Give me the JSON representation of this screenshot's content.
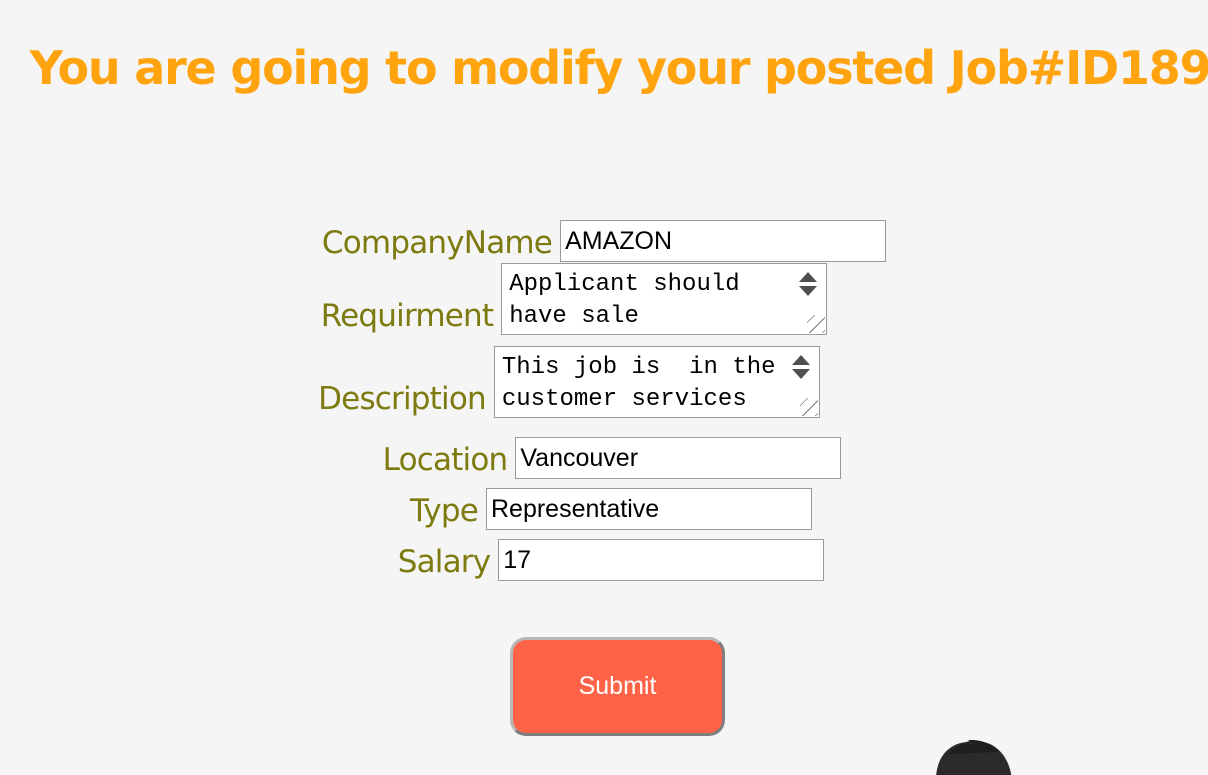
{
  "page": {
    "title": "You are going to modify your posted Job#ID189"
  },
  "form": {
    "company_name": {
      "label": "CompanyName",
      "value": "AMAZON"
    },
    "requirement": {
      "label": "Requirment",
      "value": "Applicant should have sale"
    },
    "description": {
      "label": "Description",
      "value": "This job is  in the customer services"
    },
    "location": {
      "label": "Location",
      "value": "Vancouver"
    },
    "type": {
      "label": "Type",
      "value": "Representative"
    },
    "salary": {
      "label": "Salary",
      "value": "17"
    },
    "submit_label": "Submit"
  },
  "icons": {
    "requirement_scroll_up": "triangle-up-icon",
    "requirement_scroll_down": "triangle-down-icon",
    "description_scroll_up": "triangle-up-icon",
    "description_scroll_down": "triangle-down-icon",
    "resize_grip": "resize-grip-icon",
    "mascot": "person-head-icon"
  },
  "colors": {
    "title": "#ffa30e",
    "label": "#7d7a10",
    "submit_background": "#ff6347",
    "submit_text": "#ffffff",
    "page_background": "#f5f5f5"
  }
}
